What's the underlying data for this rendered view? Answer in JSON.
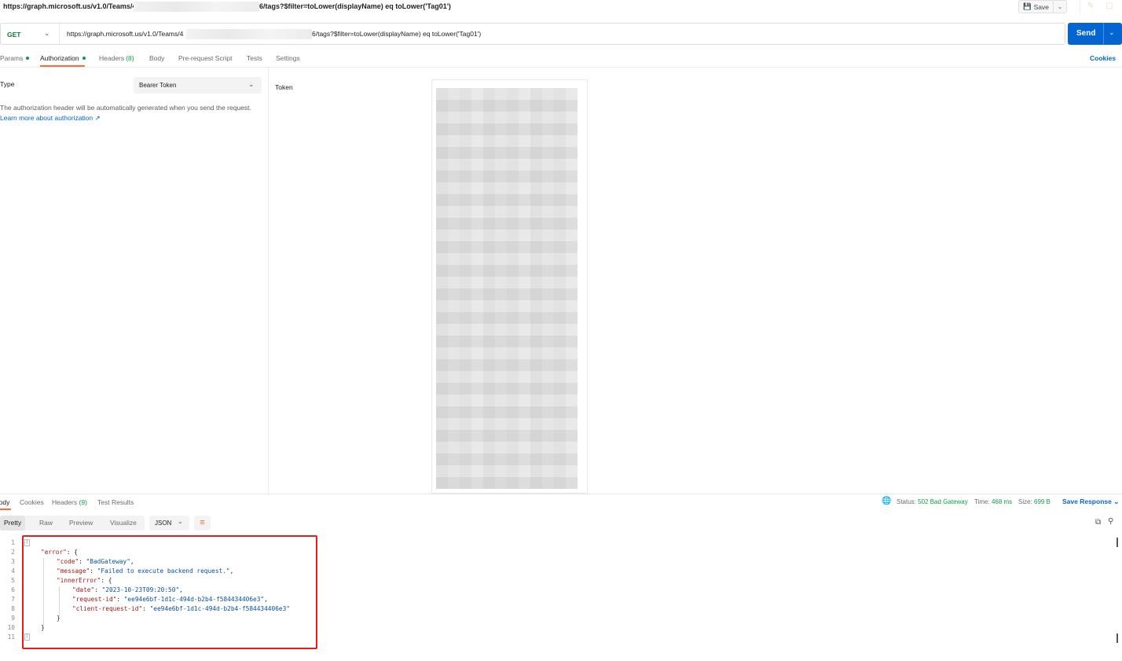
{
  "title": {
    "url_part1": "https://graph.microsoft.us/v1.0/Teams/4",
    "url_part2": "6/tags?$filter=toLower(displayName) eq toLower('Tag01')"
  },
  "toolbar": {
    "save_label": "Save"
  },
  "request": {
    "method": "GET",
    "url_part1": "https://graph.microsoft.us/v1.0/Teams/4",
    "url_part2": "6/tags?$filter=toLower(displayName) eq toLower('Tag01')",
    "send_label": "Send"
  },
  "tabs": [
    {
      "label": "Params"
    },
    {
      "label": "Authorization"
    },
    {
      "label": "Headers",
      "count": "(8)"
    },
    {
      "label": "Body"
    },
    {
      "label": "Pre-request Script"
    },
    {
      "label": "Tests"
    },
    {
      "label": "Settings"
    }
  ],
  "cookies_label": "Cookies",
  "auth": {
    "type_label": "Type",
    "type_value": "Bearer Token",
    "note": "The authorization header will be automatically generated when you send the request.",
    "learn_more": "Learn more about authorization ↗",
    "token_label": "Token"
  },
  "response": {
    "tabs": [
      {
        "label": "Body"
      },
      {
        "label": "Cookies"
      },
      {
        "label": "Headers",
        "count": "(9)"
      },
      {
        "label": "Test Results"
      }
    ],
    "status_label": "Status:",
    "status_value": "502 Bad Gateway",
    "time_label": "Time:",
    "time_value": "468 ms",
    "size_label": "Size:",
    "size_value": "699 B",
    "save_response": "Save Response",
    "formats": [
      "Pretty",
      "Raw",
      "Preview",
      "Visualize"
    ],
    "language": "JSON"
  },
  "code": {
    "line_numbers": [
      "1",
      "2",
      "3",
      "4",
      "5",
      "6",
      "7",
      "8",
      "9",
      "10",
      "11"
    ],
    "error_key": "\"error\"",
    "code_key": "\"code\"",
    "code_val": "\"BadGateway\"",
    "message_key": "\"message\"",
    "message_val": "\"Failed to execute backend request.\"",
    "inner_key": "\"innerError\"",
    "date_key": "\"date\"",
    "date_val": "\"2023-10-23T09:20:50\"",
    "reqid_key": "\"request-id\"",
    "reqid_val": "\"ee94e6bf-1d1c-494d-b2b4-f584434406e3\"",
    "creqid_key": "\"client-request-id\"",
    "creqid_val": "\"ee94e6bf-1d1c-494d-b2b4-f584434406e3\""
  },
  "colors": {
    "accent": "#ff6c37",
    "primary": "#0265d2",
    "success": "#0b9e4a",
    "highlight": "#e0201b"
  }
}
